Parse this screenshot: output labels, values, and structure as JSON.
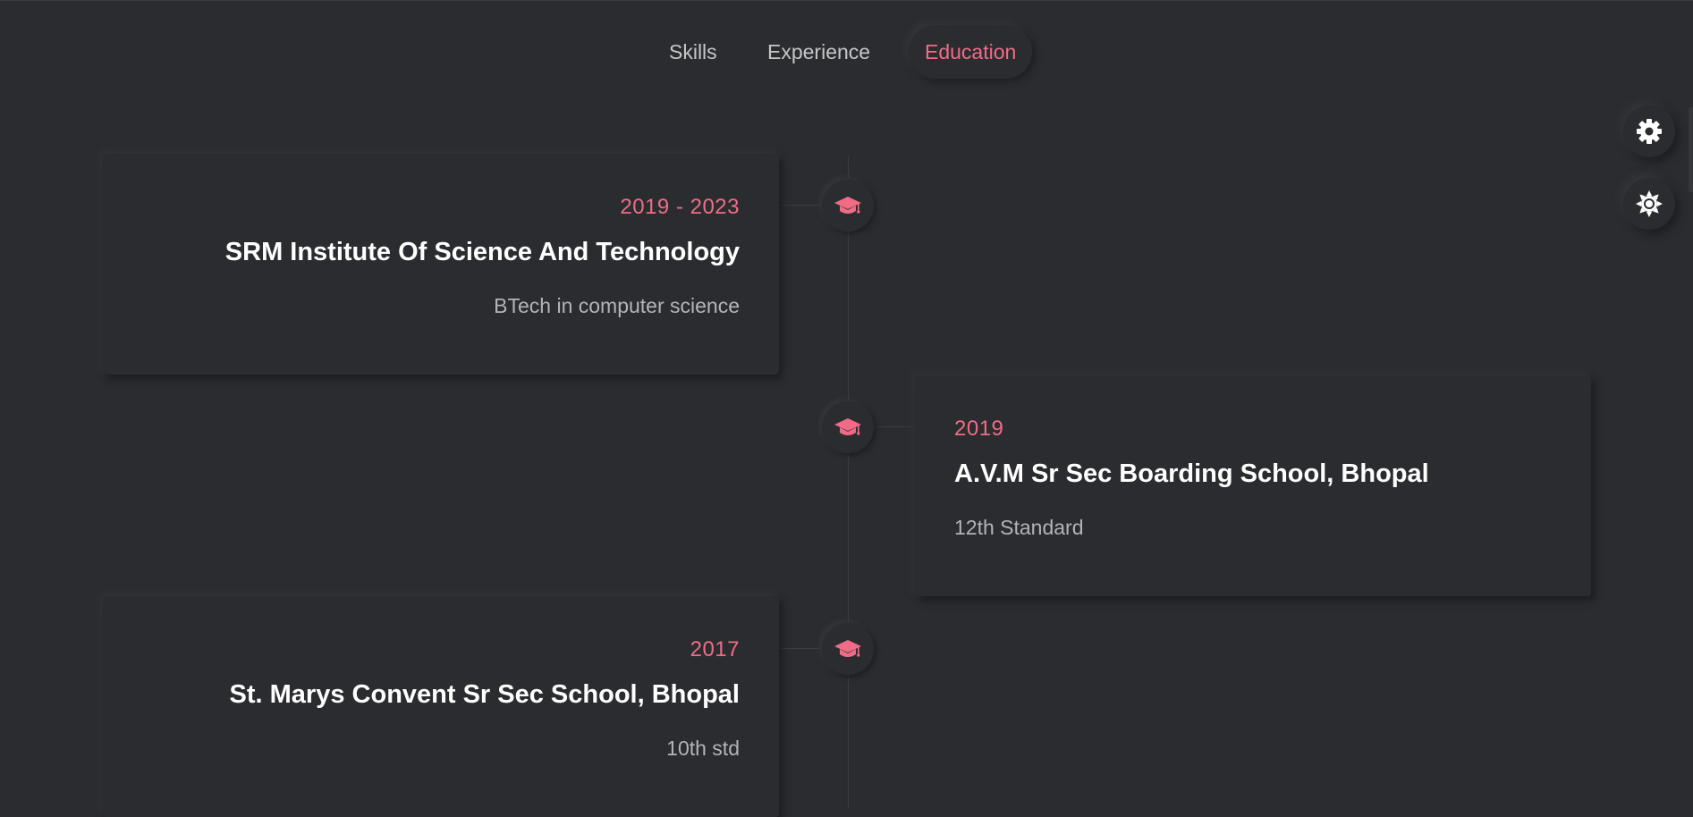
{
  "nav": {
    "tabs": [
      {
        "label": "Skills",
        "active": false
      },
      {
        "label": "Experience",
        "active": false
      },
      {
        "label": "Education",
        "active": true
      }
    ]
  },
  "side_buttons": {
    "settings_icon": "gear-icon",
    "theme_icon": "sun-icon"
  },
  "colors": {
    "accent": "#f06c86",
    "background": "#2b2c30",
    "text_primary": "#ffffff",
    "text_secondary": "#b4b4b4"
  },
  "timeline": {
    "entries": [
      {
        "date": "2019 - 2023",
        "institution": "SRM Institute Of Science And Technology",
        "degree": "BTech in computer science",
        "icon": "graduation-cap-icon"
      },
      {
        "date": "2019",
        "institution": "A.V.M Sr Sec Boarding School, Bhopal",
        "degree": "12th Standard",
        "icon": "graduation-cap-icon"
      },
      {
        "date": "2017",
        "institution": "St. Marys Convent Sr Sec School, Bhopal",
        "degree": "10th std",
        "icon": "graduation-cap-icon"
      }
    ]
  }
}
